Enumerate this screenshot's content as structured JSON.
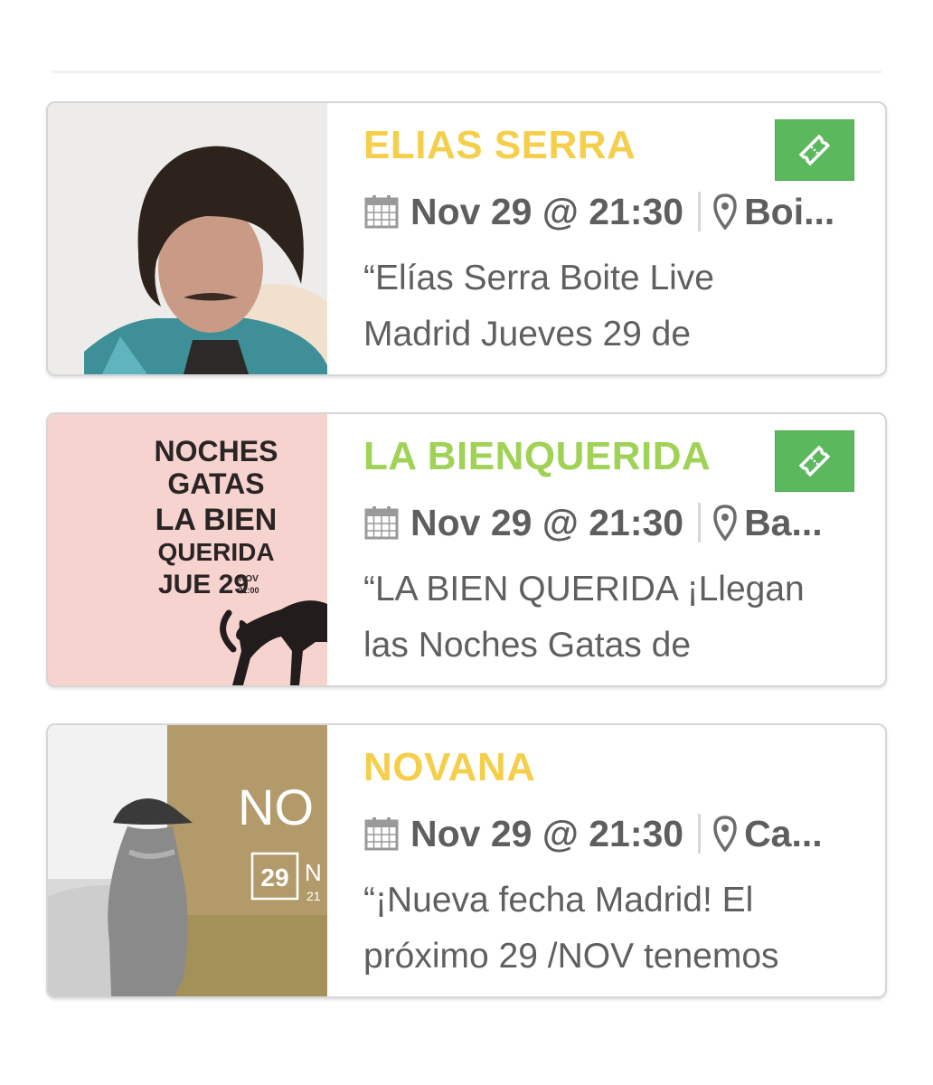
{
  "events": [
    {
      "title": "ELIAS SERRA",
      "title_color": "#f5cf4b",
      "date": "Nov 29 @ 21:30",
      "venue": "Boi...",
      "excerpt_line1": "“Elías Serra Boite Live",
      "excerpt_line2": "Madrid Jueves 29 de",
      "has_ticket": true
    },
    {
      "title": "LA BIENQUERIDA",
      "title_color": "#9fd255",
      "date": "Nov 29 @ 21:30",
      "venue": "Ba...",
      "excerpt_line1": "“LA BIEN QUERIDA ¡Llegan",
      "excerpt_line2": "las Noches Gatas de",
      "has_ticket": true,
      "poster": {
        "line1": "NOCHES",
        "line2": "GATAS",
        "line3": "LA BIEN",
        "line4": "QUERIDA",
        "line5": "JUE 29",
        "line5b": "NOV",
        "line5c": "21:00"
      }
    },
    {
      "title": "NOVANA",
      "title_color": "#f5cf4b",
      "date": "Nov 29 @ 21:30",
      "venue": "Ca...",
      "excerpt_line1": "“¡Nueva fecha Madrid! El",
      "excerpt_line2": "próximo 29 /NOV tenemos",
      "has_ticket": false,
      "poster": {
        "big": "NO",
        "day": "29",
        "sub": "N",
        "sub2": "21"
      }
    }
  ],
  "colors": {
    "ticket_button": "#5cb85c",
    "meta_text": "#5e5e5e",
    "card_border": "#d6d6d6"
  },
  "icons": {
    "calendar": "calendar-icon",
    "location": "map-pin-icon",
    "ticket": "ticket-icon"
  }
}
